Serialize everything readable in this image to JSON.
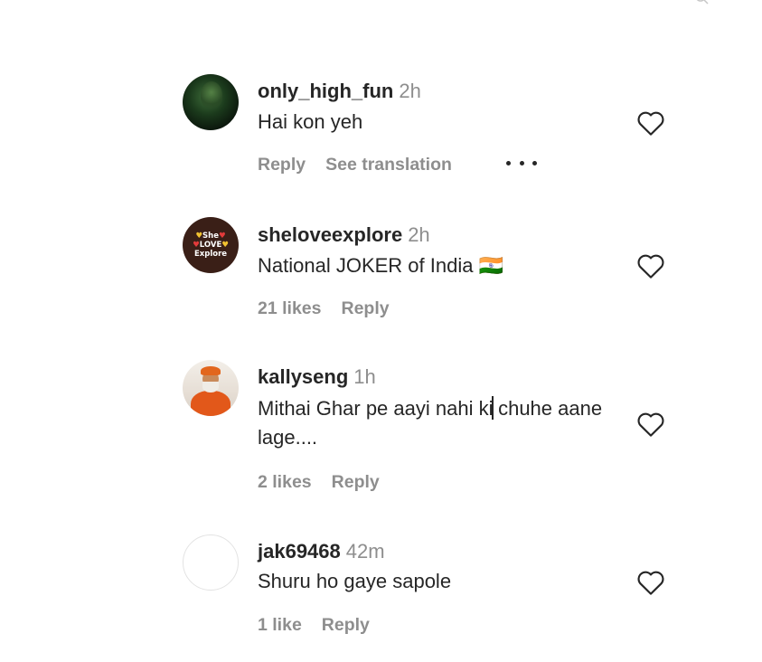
{
  "comments": [
    {
      "username": "only_high_fun",
      "time": "2h",
      "text": "Hai kon yeh",
      "likes_label": "",
      "reply_label": "Reply",
      "translate_label": "See translation"
    },
    {
      "username": "sheloveexplore",
      "time": "2h",
      "text": "National JOKER of India 🇮🇳",
      "likes_label": "21 likes",
      "reply_label": "Reply",
      "avatar_text": [
        "She",
        "LOVE",
        "Explore"
      ]
    },
    {
      "username": "kallyseng",
      "time": "1h",
      "text_before_cursor": "Mithai Ghar pe aayi nahi ki",
      "text_after_cursor": " chuhe aane lage....",
      "likes_label": "2 likes",
      "reply_label": "Reply"
    },
    {
      "username": "jak69468",
      "time": "42m",
      "text": "Shuru ho gaye sapole",
      "likes_label": "1 like",
      "reply_label": "Reply"
    }
  ],
  "icons": {
    "like": "heart-outline-icon",
    "more": "more-horizontal-icon",
    "search": "search-icon"
  },
  "colors": {
    "text": "#262626",
    "secondary": "#8e8e8e",
    "background": "#ffffff"
  }
}
